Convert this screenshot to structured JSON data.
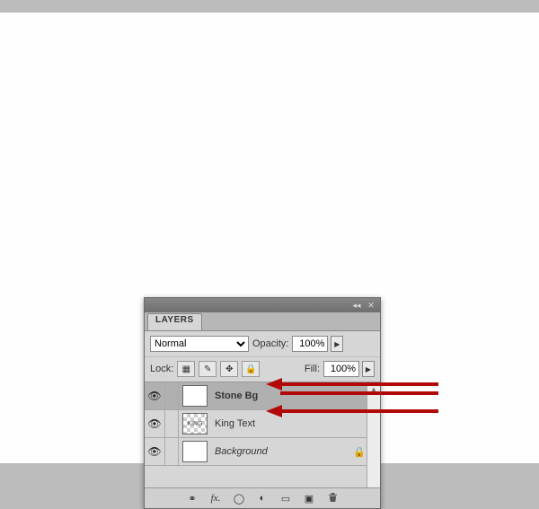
{
  "panel": {
    "title": "LAYERS",
    "blend_mode": "Normal",
    "opacity_label": "Opacity:",
    "opacity_value": "100%",
    "lock_label": "Lock:",
    "fill_label": "Fill:",
    "fill_value": "100%"
  },
  "lock_buttons": {
    "transparent": "▦",
    "pixels": "✎",
    "position": "✥",
    "all": "🔒"
  },
  "layers": [
    {
      "name": "Stone Bg",
      "thumb": "white",
      "selected": true,
      "bold": true,
      "italic": false,
      "locked": false
    },
    {
      "name": "King Text",
      "thumb": "checker",
      "thumb_text": "KING",
      "selected": false,
      "bold": false,
      "italic": false,
      "locked": false
    },
    {
      "name": "Background",
      "thumb": "white",
      "selected": false,
      "bold": false,
      "italic": true,
      "locked": true
    }
  ],
  "footer": {
    "link": "⚭",
    "fx": "fx.",
    "mask": "◯",
    "adjust": "◐",
    "group": "▭",
    "new": "▣",
    "delete": "🗑"
  },
  "header_icons": {
    "collapse": "◂◂",
    "close": "✕"
  }
}
